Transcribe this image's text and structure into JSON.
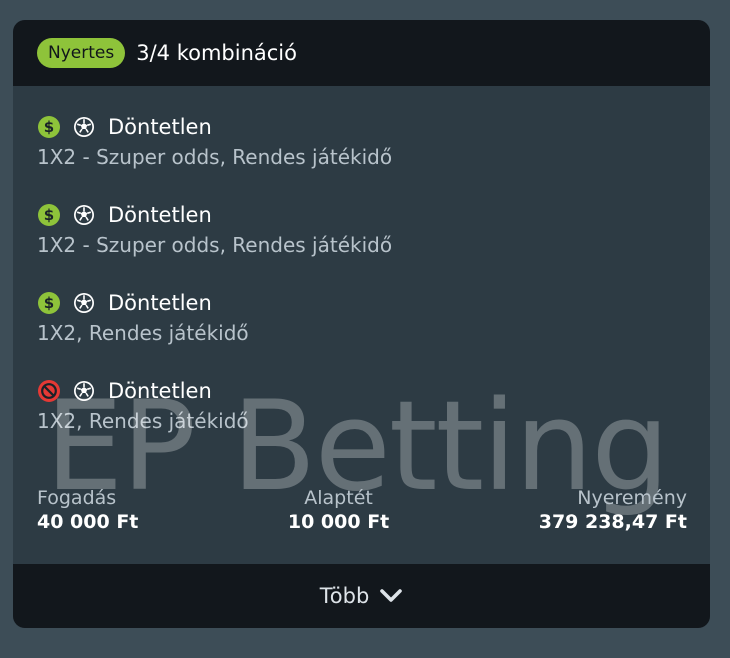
{
  "header": {
    "badge": "Nyertes",
    "title": "3/4 kombináció"
  },
  "legs": [
    {
      "status": "won",
      "status_icon": "dollar-icon",
      "sport_icon": "soccer-ball-icon",
      "selection": "Döntetlen",
      "market": "1X2 - Szuper odds, Rendes játékidő"
    },
    {
      "status": "won",
      "status_icon": "dollar-icon",
      "sport_icon": "soccer-ball-icon",
      "selection": "Döntetlen",
      "market": "1X2 - Szuper odds, Rendes játékidő"
    },
    {
      "status": "won",
      "status_icon": "dollar-icon",
      "sport_icon": "soccer-ball-icon",
      "selection": "Döntetlen",
      "market": "1X2, Rendes játékidő"
    },
    {
      "status": "lost",
      "status_icon": "prohibited-dollar-icon",
      "sport_icon": "soccer-ball-icon",
      "selection": "Döntetlen",
      "market": "1X2, Rendes játékidő"
    }
  ],
  "watermark": "EP Betting",
  "totals": {
    "stake_label": "Fogadás",
    "stake_value": "40 000 Ft",
    "unit_label": "Alaptét",
    "unit_value": "10 000 Ft",
    "win_label": "Nyeremény",
    "win_value": "379 238,47 Ft"
  },
  "more": {
    "label": "Több",
    "icon": "chevron-down-icon"
  },
  "colors": {
    "page_bg": "#3d4d57",
    "card_bg": "#2d3b44",
    "header_bg": "#12171c",
    "badge_green": "#8ec33a",
    "lost_red": "#e53935"
  }
}
